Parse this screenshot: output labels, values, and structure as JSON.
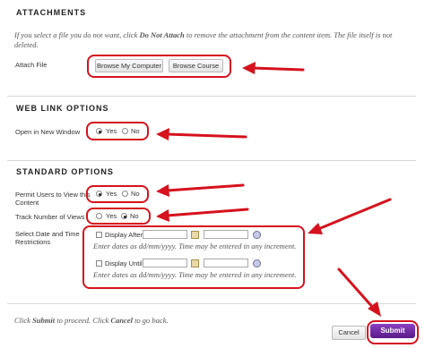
{
  "attachments": {
    "title": "ATTACHMENTS",
    "note_prefix": "If you select a file you do not want, click ",
    "note_bold": "Do Not Attach",
    "note_suffix": " to remove the attachment from the content item. The file itself is not deleted.",
    "attach_file_label": "Attach File",
    "browse_computer": "Browse My Computer",
    "browse_course": "Browse Course"
  },
  "web_link": {
    "title": "WEB LINK OPTIONS",
    "open_new_window_label": "Open in New Window",
    "yes": "Yes",
    "no": "No",
    "selected": "yes"
  },
  "standard": {
    "title": "STANDARD OPTIONS",
    "permit_users_label_1": "Permit Users to View this",
    "permit_users_label_2": "Content",
    "permit_selected": "yes",
    "track_views_label": "Track Number of Views",
    "track_selected": "no",
    "yes": "Yes",
    "no": "No",
    "date_restrictions_label_1": "Select Date and Time",
    "date_restrictions_label_2": "Restrictions",
    "display_after": "Display After",
    "display_until": "Display Until",
    "date_hint": "Enter dates as dd/mm/yyyy. Time may be entered in any increment."
  },
  "footer": {
    "hint_1": "Click ",
    "hint_submit": "Submit",
    "hint_2": " to proceed. Click ",
    "hint_cancel": "Cancel",
    "hint_3": " to go back.",
    "cancel": "Cancel",
    "submit": "Submit"
  },
  "colors": {
    "annotation_red": "#d5121d",
    "submit_purple": "#6a2aa0"
  }
}
